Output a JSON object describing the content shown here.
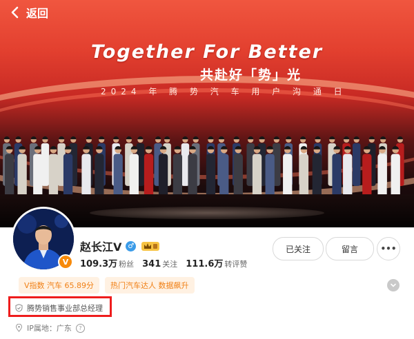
{
  "nav": {
    "back_label": "返回"
  },
  "banner": {
    "headline": "Together For Better",
    "subheadline": "共赴好「势」光",
    "event_line": "2024 年 腾 势 汽 车 用 户 沟 通 日"
  },
  "profile": {
    "name": "赵长江V",
    "stats": [
      {
        "value": "109.3万",
        "label": "粉丝"
      },
      {
        "value": "341",
        "label": "关注"
      },
      {
        "value": "111.6万",
        "label": "转评赞"
      }
    ],
    "tags": [
      "V指数 汽车 65.89分",
      "热门汽车达人 数据飙升"
    ],
    "job_title": "腾势销售事业部总经理",
    "ip_location": "IP属地：广东"
  },
  "actions": {
    "follow_label": "已关注",
    "message_label": "留言",
    "more_label": "•••"
  },
  "colors": {
    "accent_orange": "#f08016",
    "tag_bg": "#fff1e2",
    "highlight_red": "#ee1c1c",
    "banner_red": "#e3402f"
  }
}
